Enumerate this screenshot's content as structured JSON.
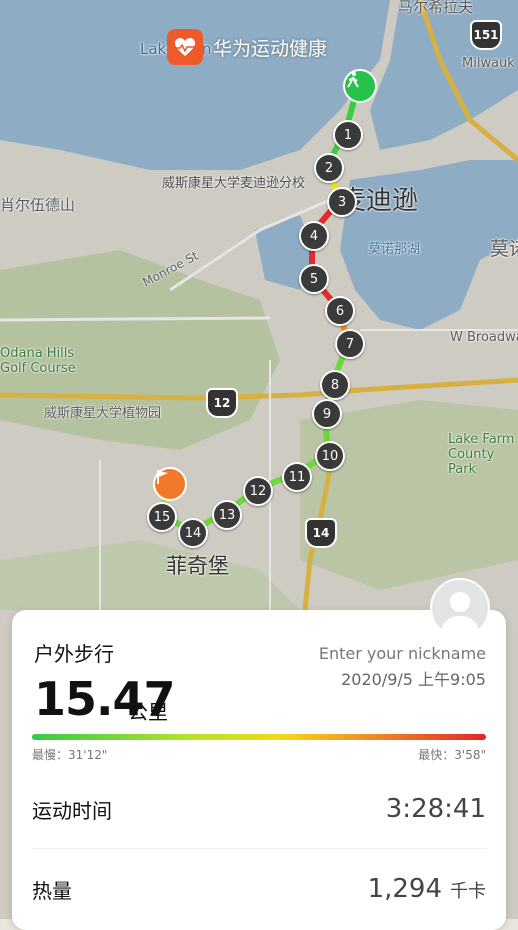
{
  "brand": {
    "name": "华为运动健康",
    "icon": "heart-logo-icon",
    "accent": "#ef5a2a"
  },
  "map": {
    "labels": {
      "top_partial": "马尔希拉夫",
      "lake_partial": "Lake Men",
      "milwaukee": "Milwauk",
      "uw_madison": "威斯康星大学麦迪逊分校",
      "madison": "麦迪逊",
      "xiaoer": "肖尔伍德山",
      "monroe": "Monroe St",
      "lake_monona": "莫诺那湖",
      "right_partial": "莫诺",
      "w_broadway": "W Broadwa",
      "odana": "Odana Hills Golf Course",
      "arboretum": "威斯康星大学植物园",
      "lake_farm": "Lake Farm County Park",
      "fitchburg": "菲奇堡"
    },
    "highways": [
      "151",
      "12",
      "14"
    ],
    "markers": [
      "1",
      "2",
      "3",
      "4",
      "5",
      "6",
      "7",
      "8",
      "9",
      "10",
      "11",
      "12",
      "13",
      "14",
      "15"
    ]
  },
  "summary": {
    "activity_type": "户外步行",
    "nickname": "Enter your nickname",
    "datetime": "2020/9/5 上午9:05",
    "distance": "15.47",
    "distance_unit": "公里",
    "slowest": "最慢：31'12\"",
    "fastest": "最快：3'58\"",
    "duration_label": "运动时间",
    "duration_value": "3:28:41",
    "calories_label": "热量",
    "calories_value": "1,294",
    "calories_unit": "千卡"
  }
}
